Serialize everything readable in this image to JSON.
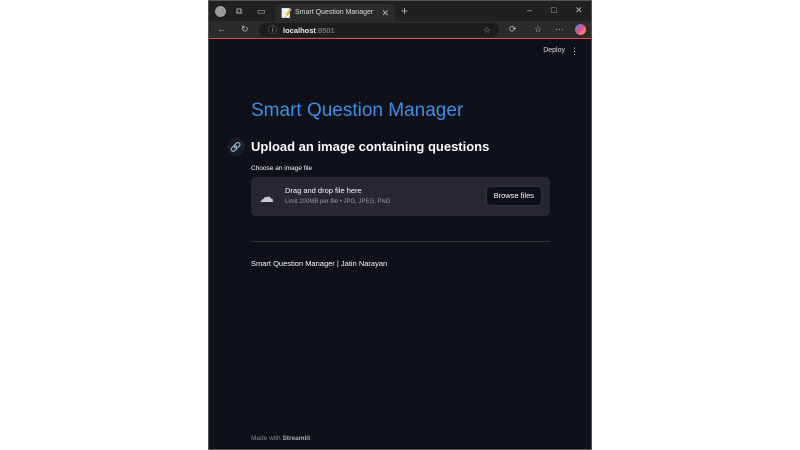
{
  "browser": {
    "tab_title": "Smart Question Manager",
    "url_host": "localhost",
    "url_port": ":8501"
  },
  "header": {
    "deploy_label": "Deploy"
  },
  "main": {
    "title": "Smart Question Manager",
    "subheader": "Upload an image containing questions",
    "uploader": {
      "label": "Choose an image file",
      "drop_text": "Drag and drop file here",
      "limit_text": "Limit 200MB per file • JPG, JPEG, PNG",
      "browse_label": "Browse files"
    },
    "footer_text": "Smart Question Manager | Jatin Narayan"
  },
  "footer": {
    "made_with": "Made with",
    "brand": "Streamlit"
  },
  "colors": {
    "accent": "#3a8ee6",
    "background": "#0e1117"
  }
}
